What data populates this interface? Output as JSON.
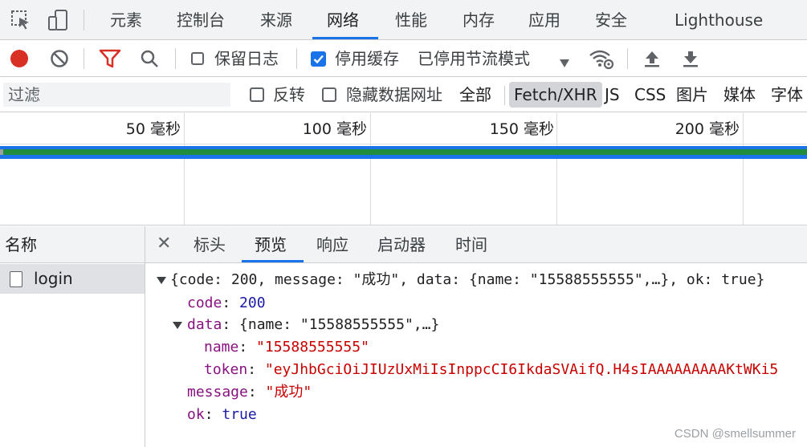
{
  "tabs": [
    {
      "label": "元素"
    },
    {
      "label": "控制台"
    },
    {
      "label": "来源"
    },
    {
      "label": "网络"
    },
    {
      "label": "性能"
    },
    {
      "label": "内存"
    },
    {
      "label": "应用"
    },
    {
      "label": "安全"
    },
    {
      "label": "Lighthouse"
    }
  ],
  "active_tab": "网络",
  "toolbar": {
    "preserve_log_label": "保留日志",
    "preserve_log_checked": false,
    "disable_cache_label": "停用缓存",
    "disable_cache_checked": true,
    "throttling_value": "已停用节流模式"
  },
  "filter": {
    "placeholder": "过滤",
    "invert_label": "反转",
    "hide_data_urls_label": "隐藏数据网址",
    "types": [
      "全部",
      "Fetch/XHR",
      "JS",
      "CSS",
      "图片",
      "媒体",
      "字体"
    ],
    "selected_type": "Fetch/XHR"
  },
  "timeline": {
    "ticks": [
      "50 毫秒",
      "100 毫秒",
      "150 毫秒",
      "200 毫秒"
    ]
  },
  "requests": {
    "header": "名称",
    "items": [
      {
        "name": "login"
      }
    ]
  },
  "detail_tabs": [
    "标头",
    "预览",
    "响应",
    "启动器",
    "时间"
  ],
  "active_detail_tab": "预览",
  "preview": {
    "summary": "{code: 200, message: \"成功\", data: {name: \"15588555555\",…}, ok: true}",
    "code_key": "code",
    "code_value": "200",
    "data_key": "data",
    "data_summary": "{name: \"15588555555\",…}",
    "name_key": "name",
    "name_value": "\"15588555555\"",
    "token_key": "token",
    "token_value": "\"eyJhbGciOiJIUzUxMiIsInppcCI6IkdaSVAifQ.H4sIAAAAAAAAAKtWKi5",
    "message_key": "message",
    "message_value": "\"成功\"",
    "ok_key": "ok",
    "ok_value": "true"
  },
  "watermark": "CSDN @smellsummer",
  "colors": {
    "accent": "#1a73e8",
    "record": "#d93025",
    "filter_icon": "#d93025",
    "waterfall_green": "#1e8e3e"
  }
}
